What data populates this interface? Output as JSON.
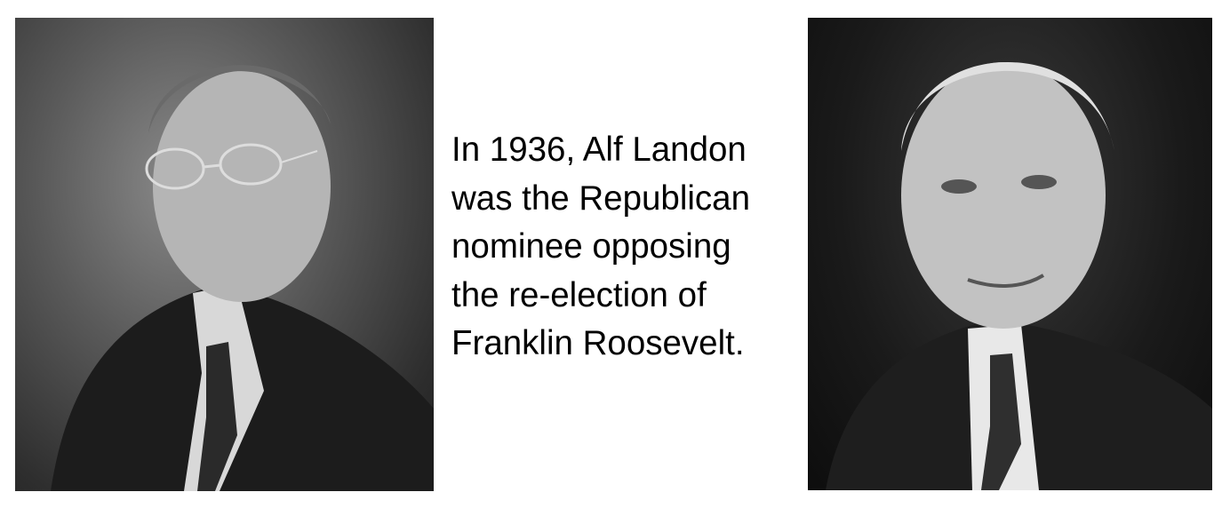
{
  "caption": {
    "lines": [
      "In 1936, Alf Landon",
      "was the Republican",
      "nominee opposing",
      "the re-election of",
      "Franklin Roosevelt."
    ]
  },
  "images": {
    "left": "portrait-alf-landon",
    "right": "portrait-franklin-roosevelt"
  }
}
